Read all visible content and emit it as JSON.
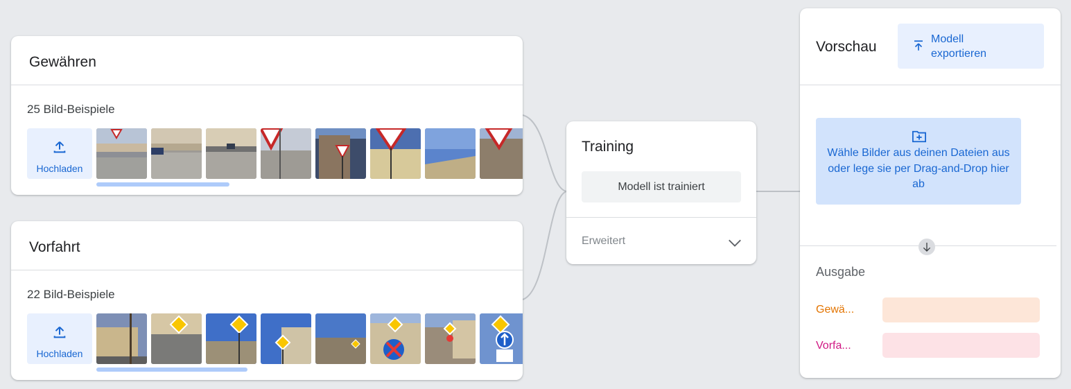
{
  "classes": [
    {
      "name": "Gewähren",
      "count_label": "25 Bild-Beispiele",
      "upload_label": "Hochladen"
    },
    {
      "name": "Vorfahrt",
      "count_label": "22 Bild-Beispiele",
      "upload_label": "Hochladen"
    }
  ],
  "training": {
    "title": "Training",
    "status_button": "Modell ist trainiert",
    "advanced_label": "Erweitert"
  },
  "preview": {
    "title": "Vorschau",
    "export_button": "Modell\nexportieren",
    "dropzone_text": "Wähle Bilder aus deinen Dateien aus oder lege sie per Drag-and-Drop hier ab",
    "output_label": "Ausgabe",
    "outputs": [
      {
        "label": "Gewä...",
        "color": "#e37400",
        "bar_color": "#fde6d8"
      },
      {
        "label": "Vorfa...",
        "color": "#d01884",
        "bar_color": "#fde2e6"
      }
    ]
  },
  "colors": {
    "accent": "#1967d2",
    "background": "#e8eaed"
  }
}
